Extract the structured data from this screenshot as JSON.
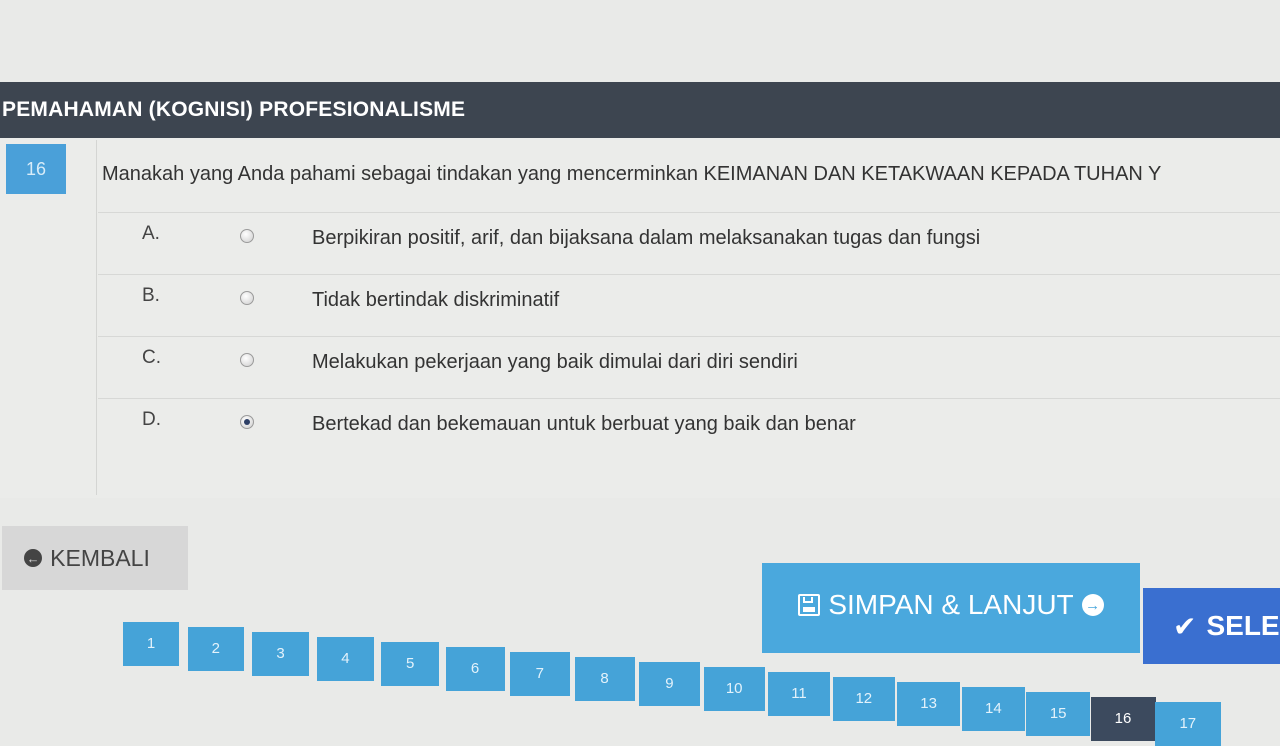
{
  "section": {
    "title": "PEMAHAMAN (KOGNISI) PROFESIONALISME"
  },
  "question": {
    "number": "16",
    "text": "Manakah yang Anda pahami sebagai tindakan yang mencerminkan KEIMANAN DAN KETAKWAAN KEPADA TUHAN Y",
    "options": [
      {
        "letter": "A.",
        "text": "Berpikiran positif, arif, dan bijaksana dalam melaksanakan tugas dan fungsi",
        "selected": false
      },
      {
        "letter": "B.",
        "text": "Tidak bertindak diskriminatif",
        "selected": false
      },
      {
        "letter": "C.",
        "text": "Melakukan pekerjaan yang baik dimulai dari diri sendiri",
        "selected": false
      },
      {
        "letter": "D.",
        "text": "Bertekad dan bekemauan untuk berbuat yang baik dan benar",
        "selected": true
      }
    ]
  },
  "nav": {
    "back_label": "KEMBALI",
    "save_label": "SIMPAN & LANJUT",
    "finish_label": "SELE"
  },
  "pagination": {
    "pages": [
      "1",
      "2",
      "3",
      "4",
      "5",
      "6",
      "7",
      "8",
      "9",
      "10",
      "11",
      "12",
      "13",
      "14",
      "15",
      "16",
      "17"
    ],
    "current": "16"
  },
  "colors": {
    "header_bg": "#3d4550",
    "primary_blue": "#4aa8dd",
    "finish_blue": "#3a6fd0",
    "active_page": "#3c4a5e"
  },
  "icons": {
    "back": "arrow-circle-left-icon",
    "save": "floppy-disk-icon",
    "next": "arrow-circle-right-icon",
    "finish": "check-icon"
  }
}
